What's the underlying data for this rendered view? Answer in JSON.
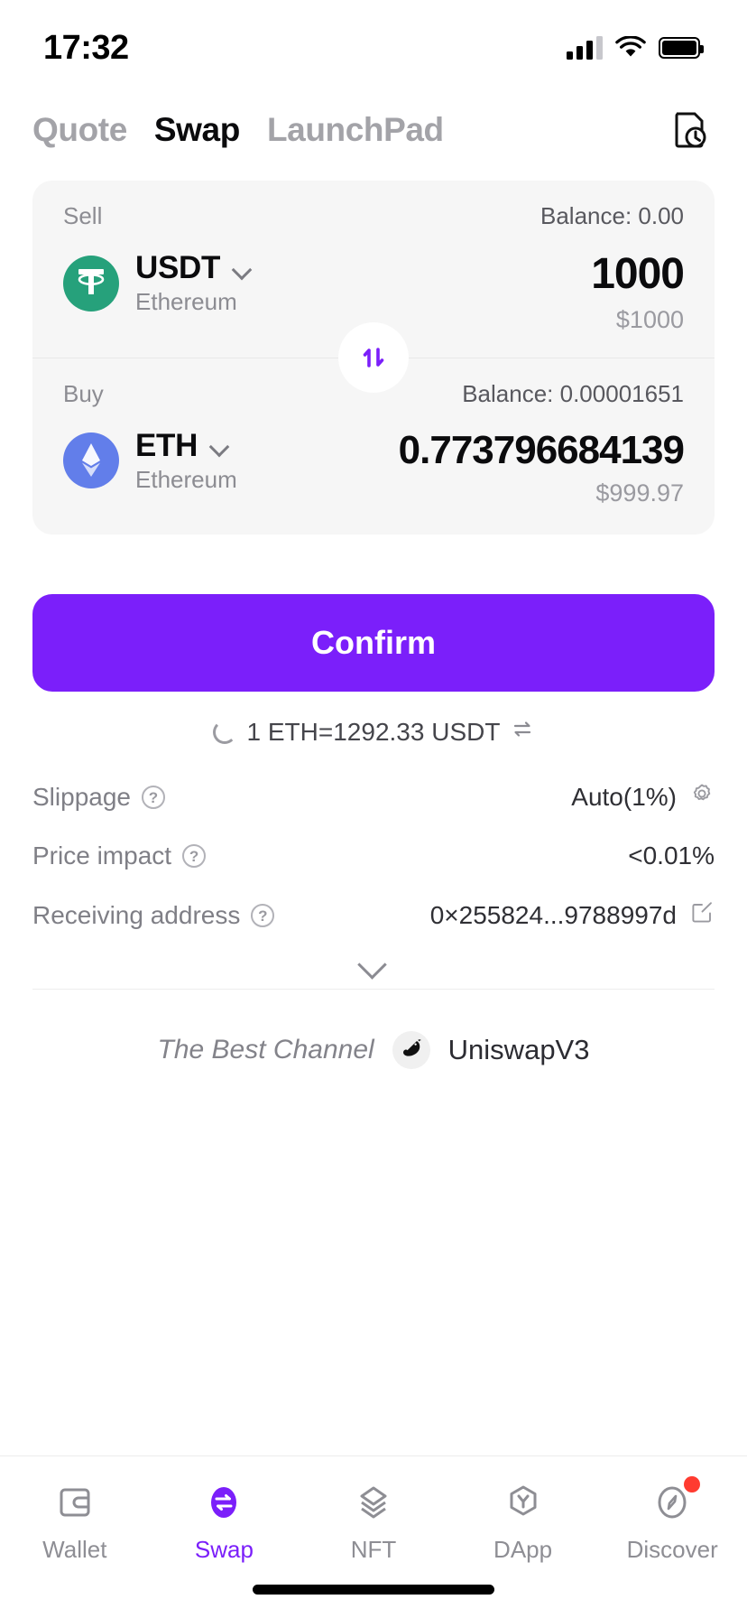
{
  "status_bar": {
    "time": "17:32",
    "cellular_icon": "cellular-signal-icon",
    "wifi_icon": "wifi-icon",
    "battery_icon": "battery-icon"
  },
  "top_tabs": {
    "items": [
      {
        "label": "Quote",
        "active": false
      },
      {
        "label": "Swap",
        "active": true
      },
      {
        "label": "LaunchPad",
        "active": false
      }
    ],
    "history_icon": "history-clock-icon"
  },
  "sell_panel": {
    "label": "Sell",
    "balance_label": "Balance: 0.00",
    "token_symbol": "USDT",
    "token_chain": "Ethereum",
    "token_logo_icon": "usdt-tether-icon",
    "token_logo_color": "#26a17b",
    "chevron_icon": "chevron-down-icon",
    "amount": "1000",
    "fiat": "$1000"
  },
  "switch_button": {
    "icon": "swap-vertical-arrows-icon",
    "color": "#7b1ffa"
  },
  "buy_panel": {
    "label": "Buy",
    "balance_label": "Balance: 0.00001651",
    "token_symbol": "ETH",
    "token_chain": "Ethereum",
    "token_logo_icon": "ethereum-diamond-icon",
    "token_logo_color": "#627eea",
    "chevron_icon": "chevron-down-icon",
    "amount": "0.773796684139",
    "fiat": "$999.97"
  },
  "confirm_button": {
    "label": "Confirm",
    "color": "#7b1ffa"
  },
  "rate": {
    "loading_icon": "loading-spinner-icon",
    "text": "1 ETH=1292.33 USDT",
    "toggle_icon": "swap-horizontal-arrows-icon"
  },
  "details": [
    {
      "label": "Slippage",
      "info_icon": "question-mark-icon",
      "value": "Auto(1%)",
      "action_icon": "gear-settings-icon"
    },
    {
      "label": "Price impact",
      "info_icon": "question-mark-icon",
      "value": "<0.01%",
      "action_icon": ""
    },
    {
      "label": "Receiving address",
      "info_icon": "question-mark-icon",
      "value": "0×255824...9788997d",
      "action_icon": "edit-pencil-icon"
    }
  ],
  "expand": {
    "icon": "chevron-down-icon"
  },
  "best_channel": {
    "label": "The Best Channel",
    "logo_icon": "uniswap-unicorn-icon",
    "name": "UniswapV3"
  },
  "bottom_nav": {
    "items": [
      {
        "label": "Wallet",
        "icon": "wallet-icon",
        "active": false,
        "badge": false
      },
      {
        "label": "Swap",
        "icon": "swap-icon",
        "active": true,
        "badge": false
      },
      {
        "label": "NFT",
        "icon": "layers-icon",
        "active": false,
        "badge": false
      },
      {
        "label": "DApp",
        "icon": "hexagon-icon",
        "active": false,
        "badge": false
      },
      {
        "label": "Discover",
        "icon": "compass-icon",
        "active": false,
        "badge": true
      }
    ],
    "active_color": "#7b1ffa"
  }
}
